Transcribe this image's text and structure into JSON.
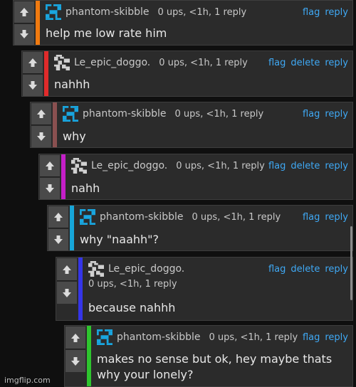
{
  "colors": {
    "link": "#3fa9f5",
    "panel": "#2b2b2b",
    "bars": [
      "#f07a10",
      "#e02b2b",
      "#8a5050",
      "#c51fc9",
      "#17a6d8",
      "#3535e8",
      "#2ec52e"
    ]
  },
  "comments": [
    {
      "username": "phantom-skibble",
      "avatar": "blue-pixel-avatar",
      "meta": "0 ups, <1h, 1 reply",
      "flag": "flag",
      "reply": "reply",
      "text": "help me low rate him"
    },
    {
      "username": "Le_epic_doggo.",
      "avatar": "gray-pixel-avatar",
      "meta": "0 ups, <1h, 1 reply",
      "flag": "flag",
      "delete": "delete",
      "reply": "reply",
      "text": "nahhh"
    },
    {
      "username": "phantom-skibble",
      "avatar": "blue-pixel-avatar",
      "meta": "0 ups, <1h, 1 reply",
      "flag": "flag",
      "reply": "reply",
      "text": "why"
    },
    {
      "username": "Le_epic_doggo.",
      "avatar": "gray-pixel-avatar",
      "meta": "0 ups, <1h, 1 reply",
      "flag": "flag",
      "delete": "delete",
      "reply": "reply",
      "text": "nahh"
    },
    {
      "username": "phantom-skibble",
      "avatar": "blue-pixel-avatar",
      "meta": "0 ups, <1h, 1 reply",
      "flag": "flag",
      "reply": "reply",
      "text": "why \"naahh\"?"
    },
    {
      "username": "Le_epic_doggo.",
      "avatar": "gray-pixel-avatar",
      "meta": "0 ups, <1h, 1 reply",
      "flag": "flag",
      "delete": "delete",
      "reply": "reply",
      "text": "because nahhh"
    },
    {
      "username": "phantom-skibble",
      "avatar": "blue-pixel-avatar",
      "meta": "0 ups, <1h, 1 reply",
      "flag": "flag",
      "reply": "reply",
      "text_line1": "makes no sense but ok, hey maybe thats",
      "text_line2": "why your lonely?"
    }
  ],
  "watermark": "imgflip.com"
}
